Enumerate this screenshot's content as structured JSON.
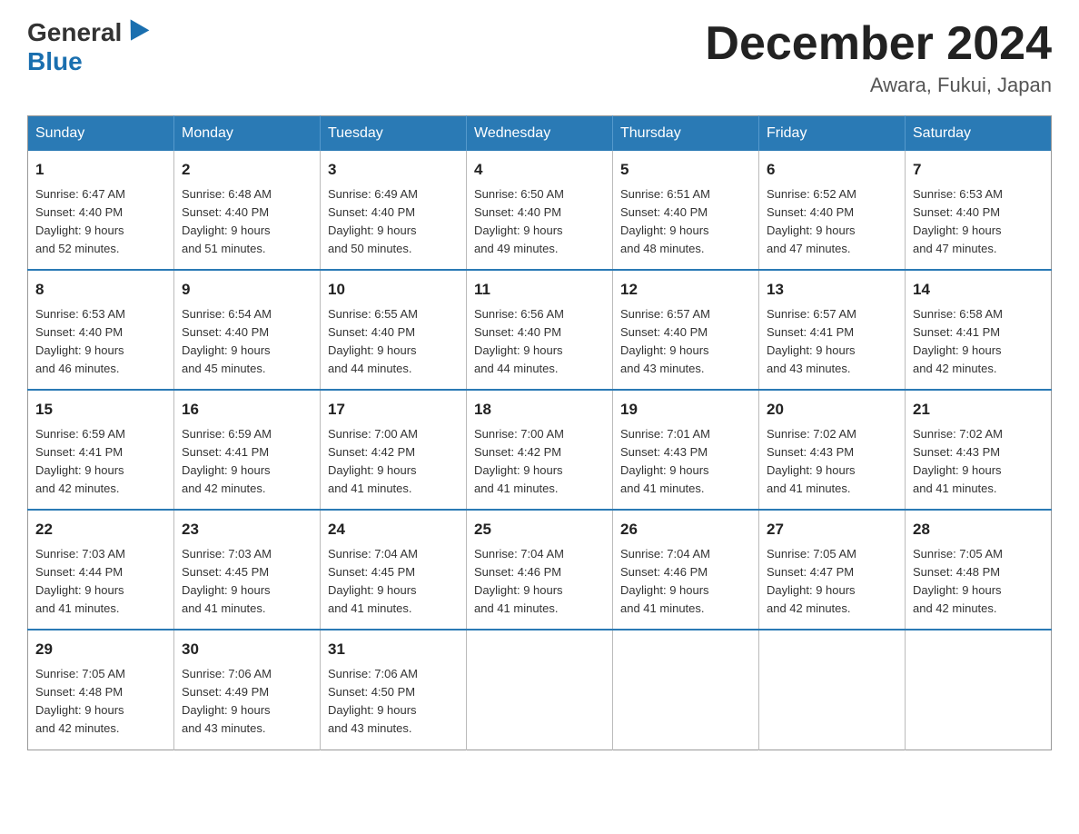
{
  "header": {
    "logo_general": "General",
    "logo_blue": "Blue",
    "month_title": "December 2024",
    "location": "Awara, Fukui, Japan"
  },
  "days_of_week": [
    "Sunday",
    "Monday",
    "Tuesday",
    "Wednesday",
    "Thursday",
    "Friday",
    "Saturday"
  ],
  "weeks": [
    [
      {
        "day": "1",
        "sunrise": "6:47 AM",
        "sunset": "4:40 PM",
        "daylight": "9 hours and 52 minutes."
      },
      {
        "day": "2",
        "sunrise": "6:48 AM",
        "sunset": "4:40 PM",
        "daylight": "9 hours and 51 minutes."
      },
      {
        "day": "3",
        "sunrise": "6:49 AM",
        "sunset": "4:40 PM",
        "daylight": "9 hours and 50 minutes."
      },
      {
        "day": "4",
        "sunrise": "6:50 AM",
        "sunset": "4:40 PM",
        "daylight": "9 hours and 49 minutes."
      },
      {
        "day": "5",
        "sunrise": "6:51 AM",
        "sunset": "4:40 PM",
        "daylight": "9 hours and 48 minutes."
      },
      {
        "day": "6",
        "sunrise": "6:52 AM",
        "sunset": "4:40 PM",
        "daylight": "9 hours and 47 minutes."
      },
      {
        "day": "7",
        "sunrise": "6:53 AM",
        "sunset": "4:40 PM",
        "daylight": "9 hours and 47 minutes."
      }
    ],
    [
      {
        "day": "8",
        "sunrise": "6:53 AM",
        "sunset": "4:40 PM",
        "daylight": "9 hours and 46 minutes."
      },
      {
        "day": "9",
        "sunrise": "6:54 AM",
        "sunset": "4:40 PM",
        "daylight": "9 hours and 45 minutes."
      },
      {
        "day": "10",
        "sunrise": "6:55 AM",
        "sunset": "4:40 PM",
        "daylight": "9 hours and 44 minutes."
      },
      {
        "day": "11",
        "sunrise": "6:56 AM",
        "sunset": "4:40 PM",
        "daylight": "9 hours and 44 minutes."
      },
      {
        "day": "12",
        "sunrise": "6:57 AM",
        "sunset": "4:40 PM",
        "daylight": "9 hours and 43 minutes."
      },
      {
        "day": "13",
        "sunrise": "6:57 AM",
        "sunset": "4:41 PM",
        "daylight": "9 hours and 43 minutes."
      },
      {
        "day": "14",
        "sunrise": "6:58 AM",
        "sunset": "4:41 PM",
        "daylight": "9 hours and 42 minutes."
      }
    ],
    [
      {
        "day": "15",
        "sunrise": "6:59 AM",
        "sunset": "4:41 PM",
        "daylight": "9 hours and 42 minutes."
      },
      {
        "day": "16",
        "sunrise": "6:59 AM",
        "sunset": "4:41 PM",
        "daylight": "9 hours and 42 minutes."
      },
      {
        "day": "17",
        "sunrise": "7:00 AM",
        "sunset": "4:42 PM",
        "daylight": "9 hours and 41 minutes."
      },
      {
        "day": "18",
        "sunrise": "7:00 AM",
        "sunset": "4:42 PM",
        "daylight": "9 hours and 41 minutes."
      },
      {
        "day": "19",
        "sunrise": "7:01 AM",
        "sunset": "4:43 PM",
        "daylight": "9 hours and 41 minutes."
      },
      {
        "day": "20",
        "sunrise": "7:02 AM",
        "sunset": "4:43 PM",
        "daylight": "9 hours and 41 minutes."
      },
      {
        "day": "21",
        "sunrise": "7:02 AM",
        "sunset": "4:43 PM",
        "daylight": "9 hours and 41 minutes."
      }
    ],
    [
      {
        "day": "22",
        "sunrise": "7:03 AM",
        "sunset": "4:44 PM",
        "daylight": "9 hours and 41 minutes."
      },
      {
        "day": "23",
        "sunrise": "7:03 AM",
        "sunset": "4:45 PM",
        "daylight": "9 hours and 41 minutes."
      },
      {
        "day": "24",
        "sunrise": "7:04 AM",
        "sunset": "4:45 PM",
        "daylight": "9 hours and 41 minutes."
      },
      {
        "day": "25",
        "sunrise": "7:04 AM",
        "sunset": "4:46 PM",
        "daylight": "9 hours and 41 minutes."
      },
      {
        "day": "26",
        "sunrise": "7:04 AM",
        "sunset": "4:46 PM",
        "daylight": "9 hours and 41 minutes."
      },
      {
        "day": "27",
        "sunrise": "7:05 AM",
        "sunset": "4:47 PM",
        "daylight": "9 hours and 42 minutes."
      },
      {
        "day": "28",
        "sunrise": "7:05 AM",
        "sunset": "4:48 PM",
        "daylight": "9 hours and 42 minutes."
      }
    ],
    [
      {
        "day": "29",
        "sunrise": "7:05 AM",
        "sunset": "4:48 PM",
        "daylight": "9 hours and 42 minutes."
      },
      {
        "day": "30",
        "sunrise": "7:06 AM",
        "sunset": "4:49 PM",
        "daylight": "9 hours and 43 minutes."
      },
      {
        "day": "31",
        "sunrise": "7:06 AM",
        "sunset": "4:50 PM",
        "daylight": "9 hours and 43 minutes."
      },
      null,
      null,
      null,
      null
    ]
  ]
}
